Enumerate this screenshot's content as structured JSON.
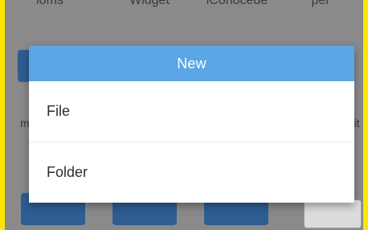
{
  "home_labels": {
    "label1": "ioms",
    "label2": "Widget",
    "label3": "iConocede",
    "label4": "per",
    "side_left": "m",
    "side_right": "it"
  },
  "dialog": {
    "title": "New",
    "items": [
      {
        "label": "File"
      },
      {
        "label": "Folder"
      }
    ]
  },
  "colors": {
    "frame": "#ffe600",
    "dialog_header": "#5aa6e6",
    "dimmed_background": "#8a8a8a"
  }
}
